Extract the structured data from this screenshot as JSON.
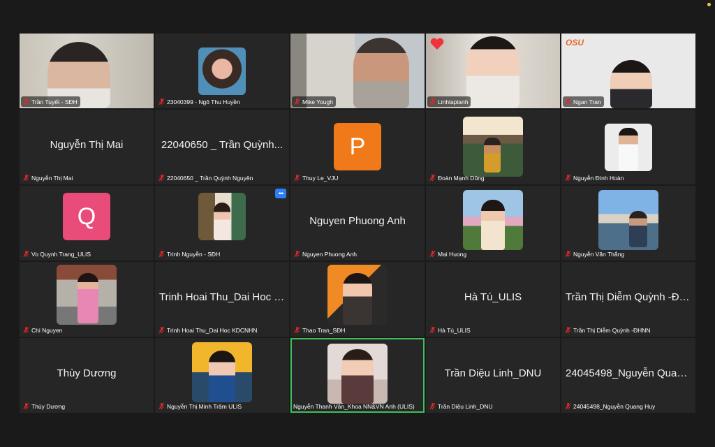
{
  "window": {
    "title": ""
  },
  "colors": {
    "background": "#1a1a1a",
    "tile": "#262626",
    "active_speaker_border": "#3fbf5b",
    "mute_icon": "#e02828",
    "avatar_p": "#f07a1a",
    "avatar_q": "#ea4c79"
  },
  "more_button_label": "•••",
  "participants": [
    {
      "label": "Trần Tuyết - SĐH",
      "type": "video"
    },
    {
      "label": "23040399 - Ngô Thu Huyền",
      "type": "thumb"
    },
    {
      "label": "Mike Yough",
      "type": "video"
    },
    {
      "label": "Linhlaplanh",
      "type": "video"
    },
    {
      "label": "Ngan Tran",
      "type": "video"
    },
    {
      "label": "Nguyễn Thị Mai",
      "big_name": "Nguyễn Thị Mai",
      "type": "name"
    },
    {
      "label": "22040650 _ Trần Quỳnh Nguyên",
      "big_name": "22040650 _ Trần Quỳnh...",
      "type": "name"
    },
    {
      "label": "Thuy Le_VJU",
      "avatar_letter": "P",
      "type": "avatar"
    },
    {
      "label": "Đoàn Mạnh Dũng",
      "type": "thumb"
    },
    {
      "label": "Nguyễn Đình Hoàn",
      "type": "thumb"
    },
    {
      "label": "Vo Quynh Trang_ULIS",
      "avatar_letter": "Q",
      "type": "avatar"
    },
    {
      "label": "Trinh Nguyễn - SĐH",
      "type": "thumb"
    },
    {
      "label": "Nguyen Phuong Anh",
      "big_name": "Nguyen Phuong Anh",
      "type": "name"
    },
    {
      "label": "Mai Huong",
      "type": "thumb"
    },
    {
      "label": "Nguyễn Văn Thắng",
      "type": "thumb"
    },
    {
      "label": "Chi Nguyen",
      "type": "thumb"
    },
    {
      "label": "Trinh Hoai Thu_Dai Hoc KDCNHN",
      "big_name": "Trinh Hoai Thu_Dai Hoc K...",
      "type": "name"
    },
    {
      "label": "Thao Tran_SĐH",
      "type": "thumb"
    },
    {
      "label": "Hà Tú_ULIS",
      "big_name": "Hà Tú_ULIS",
      "type": "name"
    },
    {
      "label": "Trần Thị Diễm Quỳnh -ĐHNN",
      "big_name": "Trần Thị Diễm Quỳnh -ĐH...",
      "type": "name"
    },
    {
      "label": "Thùy Dương",
      "big_name": "Thùy Dương",
      "type": "name"
    },
    {
      "label": "Nguyễn Thị Minh Trâm ULIS",
      "type": "thumb"
    },
    {
      "label": "Nguyễn Thanh Vân_Khoa NN&VN Anh (ULIS)",
      "type": "thumb"
    },
    {
      "label": "Trần Diệu Linh_DNU",
      "big_name": "Trần Diệu Linh_DNU",
      "type": "name"
    },
    {
      "label": "24045498_Nguyễn Quang Huy",
      "big_name": "24045498_Nguyễn Quan...",
      "type": "name"
    }
  ]
}
